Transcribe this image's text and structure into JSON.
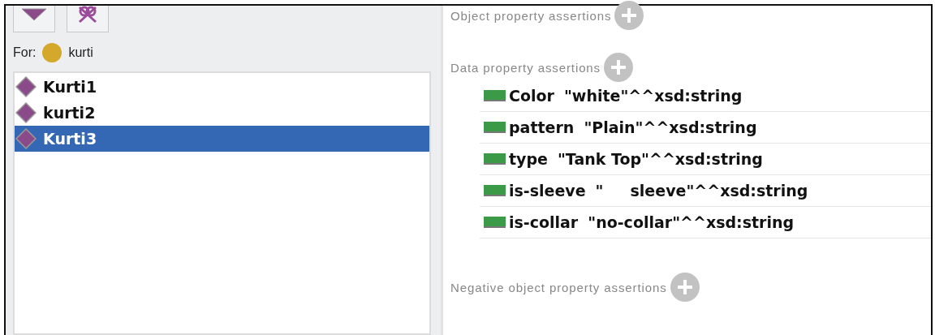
{
  "for": {
    "label": "For:",
    "entity": "kurti"
  },
  "individuals": [
    {
      "label": "Kurti1",
      "selected": false
    },
    {
      "label": "kurti2",
      "selected": false
    },
    {
      "label": "Kurti3",
      "selected": true
    }
  ],
  "sections": [
    {
      "title": "Object property assertions"
    },
    {
      "title": "Data property assertions",
      "assertions": [
        {
          "property": "Color",
          "value": "\"white\"^^xsd:string"
        },
        {
          "property": "pattern",
          "value": "\"Plain\"^^xsd:string"
        },
        {
          "property": "type",
          "value": "\"Tank Top\"^^xsd:string"
        },
        {
          "property": "is-sleeve",
          "value": "\"     sleeve\"^^xsd:string"
        },
        {
          "property": "is-collar",
          "value": "\"no-collar\"^^xsd:string"
        }
      ]
    },
    {
      "title": "Negative object property assertions"
    }
  ]
}
